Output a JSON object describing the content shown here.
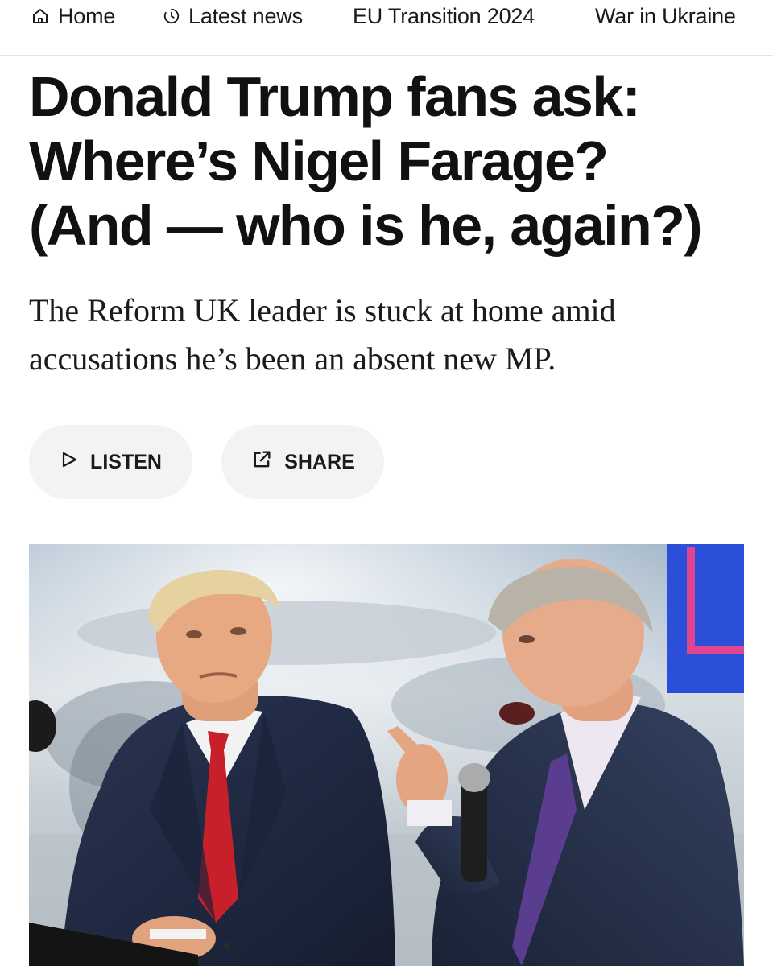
{
  "nav": {
    "items": [
      {
        "label": "Home",
        "icon": "home-icon"
      },
      {
        "label": "Latest news",
        "icon": "clock-icon"
      },
      {
        "label": "EU Transition 2024"
      },
      {
        "label": "War in Ukraine"
      }
    ]
  },
  "article": {
    "headline_lines": [
      "Donald Trump fans ask:",
      "Where’s Nigel Farage?",
      "(And — who is he, again?)"
    ],
    "dek_lines": [
      "The Reform UK leader is stuck at home amid",
      "accusations he’s been an absent new MP."
    ]
  },
  "actions": {
    "listen_label": "LISTEN",
    "listen_icon": "play-icon",
    "share_label": "SHARE",
    "share_icon": "share-icon"
  },
  "photo": {
    "description_icon": "news-photo"
  },
  "colors": {
    "text": "#111111",
    "pill_bg": "#f3f3f3",
    "divider": "#e3e3e3",
    "tie_red": "#c8202b",
    "suit_navy": "#1f2a44",
    "backdrop_blue": "#2b4fd8",
    "backdrop_pink": "#e0468f"
  }
}
